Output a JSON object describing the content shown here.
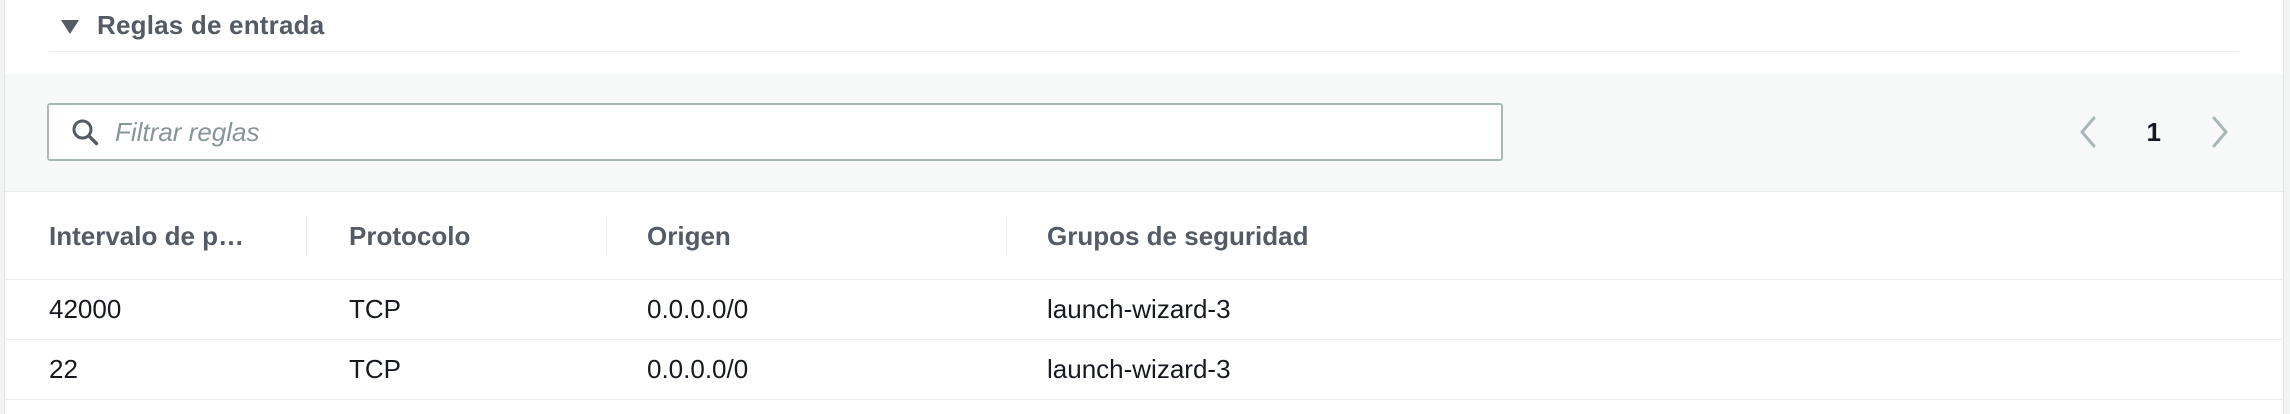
{
  "section": {
    "title": "Reglas de entrada",
    "caret_icon": "caret-down-icon"
  },
  "search": {
    "placeholder": "Filtrar reglas",
    "value": "",
    "icon": "search-icon"
  },
  "pagination": {
    "current_page": "1",
    "prev_icon": "chevron-left-icon",
    "next_icon": "chevron-right-icon"
  },
  "table": {
    "columns": [
      "Intervalo de p…",
      "Protocolo",
      "Origen",
      "Grupos de seguridad"
    ],
    "rows": [
      [
        "42000",
        "TCP",
        "0.0.0.0/0",
        "launch-wizard-3"
      ],
      [
        "22",
        "TCP",
        "0.0.0.0/0",
        "launch-wizard-3"
      ]
    ]
  },
  "colors": {
    "header_text": "#545b64",
    "body_text": "#16191f",
    "toolbar_bg": "#f7f8f8",
    "border": "#eaeded",
    "input_border": "#aab7b8",
    "placeholder": "#879596"
  }
}
